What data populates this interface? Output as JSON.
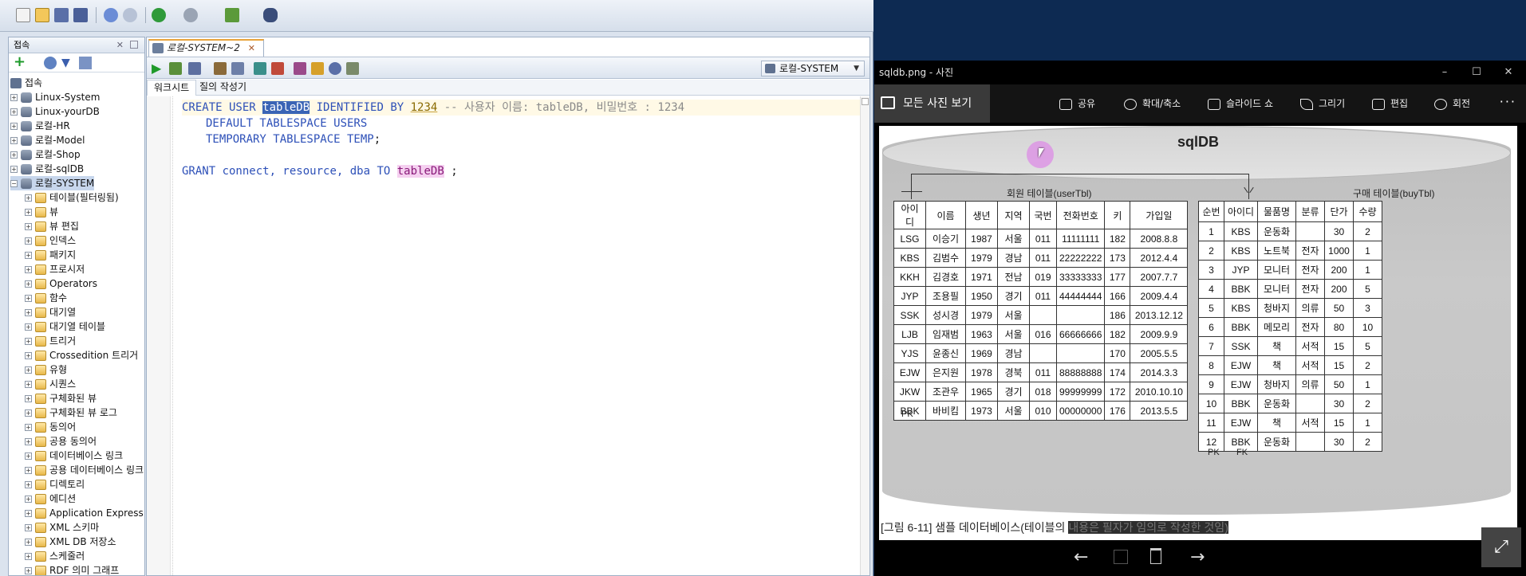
{
  "sqldev": {
    "connections_panel": {
      "title": "접속",
      "root_label": "접속"
    },
    "tree_items": [
      "Linux-System",
      "Linux-yourDB",
      "로컬-HR",
      "로컬-Model",
      "로컬-Shop",
      "로컬-sqlDB",
      "로컬-SYSTEM"
    ],
    "system_children": [
      "테이블(필터링됨)",
      "뷰",
      "뷰 편집",
      "인덱스",
      "패키지",
      "프로시저",
      "Operators",
      "함수",
      "대기열",
      "대기열 테이블",
      "트리거",
      "Crossedition 트리거",
      "유형",
      "시퀀스",
      "구체화된 뷰",
      "구체화된 뷰 로그",
      "동의어",
      "공용 동의어",
      "데이터베이스 링크",
      "공용 데이터베이스 링크",
      "디렉토리",
      "에디션",
      "Application Express",
      "XML 스키마",
      "XML DB 저장소",
      "스케줄러",
      "RDF 의미 그래프"
    ],
    "document_tab": "로컬-SYSTEM~2",
    "connection_select": "로컬-SYSTEM",
    "subtabs": {
      "worksheet": "워크시트",
      "query_builder": "질의 작성기"
    },
    "code": {
      "l1": {
        "create_user": "CREATE USER ",
        "user": "tableDB",
        "identified_by": " IDENTIFIED BY ",
        "pw": "1234",
        "comment": " -- 사용자 이름: tableDB, 비밀번호 : 1234"
      },
      "l2": {
        "kw": "DEFAULT TABLESPACE USERS"
      },
      "l3": {
        "kw": "TEMPORARY TABLESPACE TEMP",
        "end": ";"
      },
      "l4": {
        "grant": "GRANT ",
        "privs": "connect, resource, dba ",
        "to": "TO ",
        "user": "tableDB",
        "end": " ;"
      }
    }
  },
  "photos": {
    "window_title": "sqldb.png - 사진",
    "window_controls": {
      "min": "–",
      "max": "☐",
      "close": "✕"
    },
    "all_photos": "모든 사진 보기",
    "actions": {
      "share": "공유",
      "zoom": "확대/축소",
      "slideshow": "슬라이드 쇼",
      "draw": "그리기",
      "edit": "편집",
      "rotate": "회전",
      "more": "···"
    },
    "image": {
      "db_title": "sqlDB",
      "user_table_caption": "회원 테이블(userTbl)",
      "buy_table_caption": "구매 테이블(buyTbl)",
      "user_headers": [
        "아이디",
        "이름",
        "생년",
        "지역",
        "국번",
        "전화번호",
        "키",
        "가입일"
      ],
      "user_rows": [
        [
          "LSG",
          "이승기",
          "1987",
          "서울",
          "011",
          "11111111",
          "182",
          "2008.8.8"
        ],
        [
          "KBS",
          "김범수",
          "1979",
          "경남",
          "011",
          "22222222",
          "173",
          "2012.4.4"
        ],
        [
          "KKH",
          "김경호",
          "1971",
          "전남",
          "019",
          "33333333",
          "177",
          "2007.7.7"
        ],
        [
          "JYP",
          "조용필",
          "1950",
          "경기",
          "011",
          "44444444",
          "166",
          "2009.4.4"
        ],
        [
          "SSK",
          "성시경",
          "1979",
          "서울",
          "",
          "",
          "186",
          "2013.12.12"
        ],
        [
          "LJB",
          "임재범",
          "1963",
          "서울",
          "016",
          "66666666",
          "182",
          "2009.9.9"
        ],
        [
          "YJS",
          "윤종신",
          "1969",
          "경남",
          "",
          "",
          "170",
          "2005.5.5"
        ],
        [
          "EJW",
          "은지원",
          "1978",
          "경북",
          "011",
          "88888888",
          "174",
          "2014.3.3"
        ],
        [
          "JKW",
          "조관우",
          "1965",
          "경기",
          "018",
          "99999999",
          "172",
          "2010.10.10"
        ],
        [
          "BBK",
          "바비킴",
          "1973",
          "서울",
          "010",
          "00000000",
          "176",
          "2013.5.5"
        ]
      ],
      "buy_headers": [
        "순번",
        "아이디",
        "물품명",
        "분류",
        "단가",
        "수량"
      ],
      "buy_rows": [
        [
          "1",
          "KBS",
          "운동화",
          "",
          "30",
          "2"
        ],
        [
          "2",
          "KBS",
          "노트북",
          "전자",
          "1000",
          "1"
        ],
        [
          "3",
          "JYP",
          "모니터",
          "전자",
          "200",
          "1"
        ],
        [
          "4",
          "BBK",
          "모니터",
          "전자",
          "200",
          "5"
        ],
        [
          "5",
          "KBS",
          "청바지",
          "의류",
          "50",
          "3"
        ],
        [
          "6",
          "BBK",
          "메모리",
          "전자",
          "80",
          "10"
        ],
        [
          "7",
          "SSK",
          "책",
          "서적",
          "15",
          "5"
        ],
        [
          "8",
          "EJW",
          "책",
          "서적",
          "15",
          "2"
        ],
        [
          "9",
          "EJW",
          "청바지",
          "의류",
          "50",
          "1"
        ],
        [
          "10",
          "BBK",
          "운동화",
          "",
          "30",
          "2"
        ],
        [
          "11",
          "EJW",
          "책",
          "서적",
          "15",
          "1"
        ],
        [
          "12",
          "BBK",
          "운동화",
          "",
          "30",
          "2"
        ]
      ],
      "pk_label": "PK",
      "fk_label": "FK",
      "caption_main": "[그림 6-11] 샘플 데이터베이스(테이블의 ",
      "caption_dim": "내용은 필자가 임의로 작성한 것임)"
    },
    "nav": {
      "prev": "←",
      "next": "→",
      "expand": "⤢"
    }
  }
}
